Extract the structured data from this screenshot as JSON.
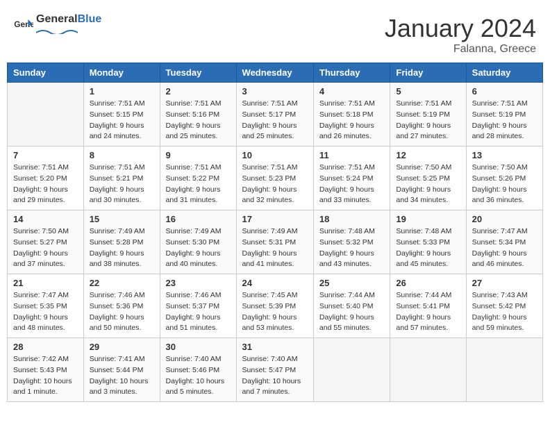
{
  "header": {
    "logo_general": "General",
    "logo_blue": "Blue",
    "month_year": "January 2024",
    "location": "Falanna, Greece"
  },
  "weekdays": [
    "Sunday",
    "Monday",
    "Tuesday",
    "Wednesday",
    "Thursday",
    "Friday",
    "Saturday"
  ],
  "weeks": [
    [
      {
        "day": "",
        "detail": ""
      },
      {
        "day": "1",
        "detail": "Sunrise: 7:51 AM\nSunset: 5:15 PM\nDaylight: 9 hours\nand 24 minutes."
      },
      {
        "day": "2",
        "detail": "Sunrise: 7:51 AM\nSunset: 5:16 PM\nDaylight: 9 hours\nand 25 minutes."
      },
      {
        "day": "3",
        "detail": "Sunrise: 7:51 AM\nSunset: 5:17 PM\nDaylight: 9 hours\nand 25 minutes."
      },
      {
        "day": "4",
        "detail": "Sunrise: 7:51 AM\nSunset: 5:18 PM\nDaylight: 9 hours\nand 26 minutes."
      },
      {
        "day": "5",
        "detail": "Sunrise: 7:51 AM\nSunset: 5:19 PM\nDaylight: 9 hours\nand 27 minutes."
      },
      {
        "day": "6",
        "detail": "Sunrise: 7:51 AM\nSunset: 5:19 PM\nDaylight: 9 hours\nand 28 minutes."
      }
    ],
    [
      {
        "day": "7",
        "detail": "Sunrise: 7:51 AM\nSunset: 5:20 PM\nDaylight: 9 hours\nand 29 minutes."
      },
      {
        "day": "8",
        "detail": "Sunrise: 7:51 AM\nSunset: 5:21 PM\nDaylight: 9 hours\nand 30 minutes."
      },
      {
        "day": "9",
        "detail": "Sunrise: 7:51 AM\nSunset: 5:22 PM\nDaylight: 9 hours\nand 31 minutes."
      },
      {
        "day": "10",
        "detail": "Sunrise: 7:51 AM\nSunset: 5:23 PM\nDaylight: 9 hours\nand 32 minutes."
      },
      {
        "day": "11",
        "detail": "Sunrise: 7:51 AM\nSunset: 5:24 PM\nDaylight: 9 hours\nand 33 minutes."
      },
      {
        "day": "12",
        "detail": "Sunrise: 7:50 AM\nSunset: 5:25 PM\nDaylight: 9 hours\nand 34 minutes."
      },
      {
        "day": "13",
        "detail": "Sunrise: 7:50 AM\nSunset: 5:26 PM\nDaylight: 9 hours\nand 36 minutes."
      }
    ],
    [
      {
        "day": "14",
        "detail": "Sunrise: 7:50 AM\nSunset: 5:27 PM\nDaylight: 9 hours\nand 37 minutes."
      },
      {
        "day": "15",
        "detail": "Sunrise: 7:49 AM\nSunset: 5:28 PM\nDaylight: 9 hours\nand 38 minutes."
      },
      {
        "day": "16",
        "detail": "Sunrise: 7:49 AM\nSunset: 5:30 PM\nDaylight: 9 hours\nand 40 minutes."
      },
      {
        "day": "17",
        "detail": "Sunrise: 7:49 AM\nSunset: 5:31 PM\nDaylight: 9 hours\nand 41 minutes."
      },
      {
        "day": "18",
        "detail": "Sunrise: 7:48 AM\nSunset: 5:32 PM\nDaylight: 9 hours\nand 43 minutes."
      },
      {
        "day": "19",
        "detail": "Sunrise: 7:48 AM\nSunset: 5:33 PM\nDaylight: 9 hours\nand 45 minutes."
      },
      {
        "day": "20",
        "detail": "Sunrise: 7:47 AM\nSunset: 5:34 PM\nDaylight: 9 hours\nand 46 minutes."
      }
    ],
    [
      {
        "day": "21",
        "detail": "Sunrise: 7:47 AM\nSunset: 5:35 PM\nDaylight: 9 hours\nand 48 minutes."
      },
      {
        "day": "22",
        "detail": "Sunrise: 7:46 AM\nSunset: 5:36 PM\nDaylight: 9 hours\nand 50 minutes."
      },
      {
        "day": "23",
        "detail": "Sunrise: 7:46 AM\nSunset: 5:37 PM\nDaylight: 9 hours\nand 51 minutes."
      },
      {
        "day": "24",
        "detail": "Sunrise: 7:45 AM\nSunset: 5:39 PM\nDaylight: 9 hours\nand 53 minutes."
      },
      {
        "day": "25",
        "detail": "Sunrise: 7:44 AM\nSunset: 5:40 PM\nDaylight: 9 hours\nand 55 minutes."
      },
      {
        "day": "26",
        "detail": "Sunrise: 7:44 AM\nSunset: 5:41 PM\nDaylight: 9 hours\nand 57 minutes."
      },
      {
        "day": "27",
        "detail": "Sunrise: 7:43 AM\nSunset: 5:42 PM\nDaylight: 9 hours\nand 59 minutes."
      }
    ],
    [
      {
        "day": "28",
        "detail": "Sunrise: 7:42 AM\nSunset: 5:43 PM\nDaylight: 10 hours\nand 1 minute."
      },
      {
        "day": "29",
        "detail": "Sunrise: 7:41 AM\nSunset: 5:44 PM\nDaylight: 10 hours\nand 3 minutes."
      },
      {
        "day": "30",
        "detail": "Sunrise: 7:40 AM\nSunset: 5:46 PM\nDaylight: 10 hours\nand 5 minutes."
      },
      {
        "day": "31",
        "detail": "Sunrise: 7:40 AM\nSunset: 5:47 PM\nDaylight: 10 hours\nand 7 minutes."
      },
      {
        "day": "",
        "detail": ""
      },
      {
        "day": "",
        "detail": ""
      },
      {
        "day": "",
        "detail": ""
      }
    ]
  ]
}
